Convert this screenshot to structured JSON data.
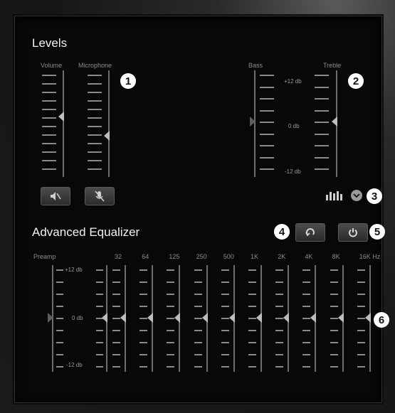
{
  "levels": {
    "title": "Levels",
    "volume_label": "Volume",
    "microphone_label": "Microphone",
    "bass_label": "Bass",
    "treble_label": "Treble",
    "db_top": "+12 db",
    "db_mid": "0 db",
    "db_bottom": "-12 db",
    "volume_level": 0.55,
    "microphone_level": 0.35,
    "bass_db": 0,
    "treble_db": 0,
    "mute_speaker_icon": "speaker-mute-icon",
    "mute_mic_icon": "microphone-mute-icon",
    "presets_icon": "equalizer-bars-icon",
    "expand_icon": "chevron-down-icon"
  },
  "equalizer": {
    "title": "Advanced Equalizer",
    "preamp_label": "Preamp",
    "db_top": "+12 db",
    "db_mid": "0 db",
    "db_bottom": "-12 db",
    "bands": [
      {
        "label": "32",
        "db": 0
      },
      {
        "label": "64",
        "db": 0
      },
      {
        "label": "125",
        "db": 0
      },
      {
        "label": "250",
        "db": 0
      },
      {
        "label": "500",
        "db": 0
      },
      {
        "label": "1K",
        "db": 0
      },
      {
        "label": "2K",
        "db": 0
      },
      {
        "label": "4K",
        "db": 0
      },
      {
        "label": "8K",
        "db": 0
      },
      {
        "label": "16K Hz",
        "db": 0
      }
    ],
    "preamp_db": 0,
    "reset_icon": "reset-icon",
    "power_icon": "power-icon"
  },
  "callouts": [
    "1",
    "2",
    "3",
    "4",
    "5",
    "6"
  ],
  "colors": {
    "panel": "#080808",
    "tick": "#8a8a8a",
    "knob": "#bdbdbd",
    "badge": "#ffffff"
  }
}
